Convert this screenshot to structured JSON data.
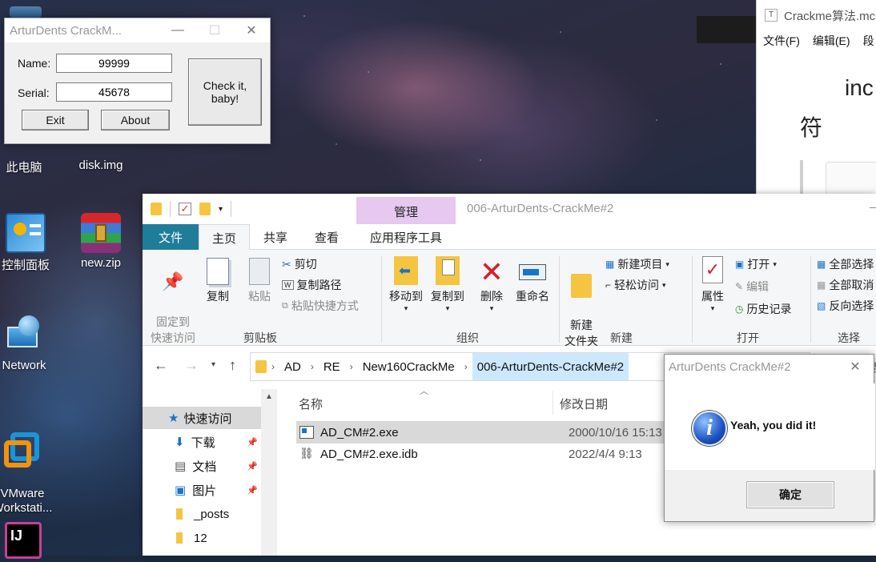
{
  "desktop": {
    "icons": [
      {
        "label": "此电脑"
      },
      {
        "label": "disk.img"
      },
      {
        "label": "控制面板"
      },
      {
        "label": "new.zip"
      },
      {
        "label": "Network"
      },
      {
        "label": "VMware\nWorkstati..."
      },
      {
        "label": "IJ"
      }
    ]
  },
  "crackme": {
    "title": "ArturDents CrackM...",
    "name_label": "Name:",
    "name_value": "99999",
    "serial_label": "Serial:",
    "serial_value": "45678",
    "check_label": "Check it,\nbaby!",
    "exit_label": "Exit",
    "about_label": "About"
  },
  "notepad": {
    "title": "Crackme算法.mc",
    "menu": [
      "文件(F)",
      "编辑(E)",
      "段"
    ],
    "text_line1": "inc",
    "text_line2": "符"
  },
  "explorer": {
    "title": "006-ArturDents-CrackMe#2",
    "manage_label": "管理",
    "tabs": [
      "文件",
      "主页",
      "共享",
      "查看",
      "应用程序工具"
    ],
    "ribbon": {
      "pin_label": "固定到\n快速访问",
      "copy_label": "复制",
      "paste_label": "粘贴",
      "cut_label": "剪切",
      "copy_path_label": "复制路径",
      "paste_shortcut_label": "粘贴快捷方式",
      "clipboard_group": "剪贴板",
      "move_to_label": "移动到",
      "copy_to_label": "复制到",
      "delete_label": "删除",
      "rename_label": "重命名",
      "organize_group": "组织",
      "new_folder_label": "新建\n文件夹",
      "new_item_label": "新建项目",
      "easy_access_label": "轻松访问",
      "new_group": "新建",
      "properties_label": "属性",
      "open_label": "打开",
      "edit_label": "编辑",
      "history_label": "历史记录",
      "open_group": "打开",
      "select_all_label": "全部选择",
      "select_none_label": "全部取消",
      "invert_label": "反向选择",
      "select_group": "选择"
    },
    "breadcrumb": [
      "AD",
      "RE",
      "New160CrackMe",
      "006-ArturDents-CrackMe#2"
    ],
    "search_label": "搜",
    "nav": [
      {
        "label": "快速访问"
      },
      {
        "label": "下载"
      },
      {
        "label": "文档"
      },
      {
        "label": "图片"
      },
      {
        "label": "_posts"
      },
      {
        "label": "12"
      }
    ],
    "columns": {
      "name": "名称",
      "date": "修改日期"
    },
    "files": [
      {
        "name": "AD_CM#2.exe",
        "date": "2000/10/16 15:13"
      },
      {
        "name": "AD_CM#2.exe.idb",
        "date": "2022/4/4 9:13"
      }
    ]
  },
  "msgbox": {
    "title": "ArturDents CrackMe#2",
    "message": "Yeah, you did it!",
    "ok_label": "确定"
  },
  "colors": {
    "accent": "#0078d7",
    "file_tab": "#1f7d9a",
    "manage_tab": "#e6c8f0"
  }
}
